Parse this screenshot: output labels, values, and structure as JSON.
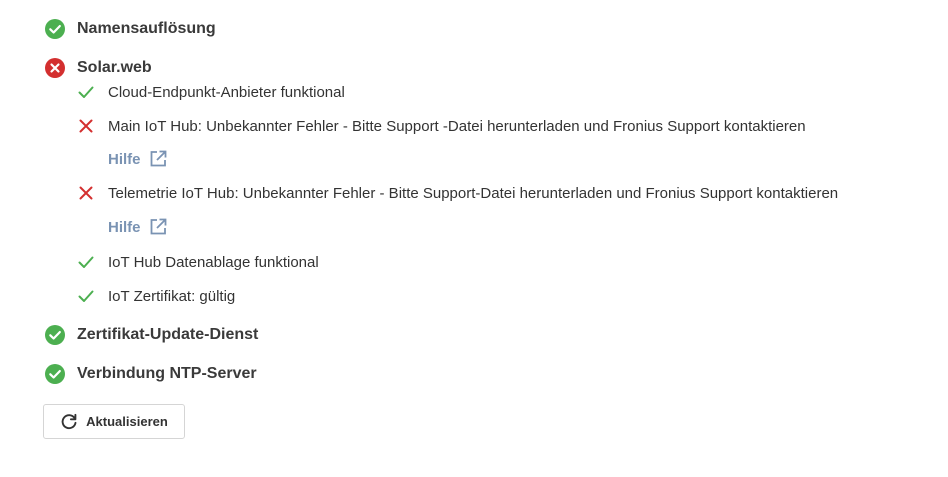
{
  "colors": {
    "ok": "#4caf50",
    "error": "#d32f2f",
    "link": "#7a93b3"
  },
  "checks": [
    {
      "label": "Namensauflösung",
      "status": "ok",
      "icon": "check-circle-icon"
    },
    {
      "label": "Solar.web",
      "status": "error",
      "icon": "error-circle-icon",
      "subchecks": [
        {
          "label": "Cloud-Endpunkt-Anbieter funktional",
          "status": "ok",
          "icon": "check-icon"
        },
        {
          "label": "Main IoT Hub: Unbekannter Fehler - Bitte Support -Datei herunterladen und Fronius Support kontaktieren",
          "status": "error",
          "icon": "cross-icon",
          "help": "Hilfe"
        },
        {
          "label": "Telemetrie IoT Hub: Unbekannter Fehler - Bitte Support-Datei herunterladen und Fronius Support kontaktieren",
          "status": "error",
          "icon": "cross-icon",
          "help": "Hilfe"
        },
        {
          "label": "IoT Hub Datenablage funktional",
          "status": "ok",
          "icon": "check-icon"
        },
        {
          "label": "IoT Zertifikat: gültig",
          "status": "ok",
          "icon": "check-icon"
        }
      ]
    },
    {
      "label": "Zertifikat-Update-Dienst",
      "status": "ok",
      "icon": "check-circle-icon"
    },
    {
      "label": "Verbindung NTP-Server",
      "status": "ok",
      "icon": "check-circle-icon"
    }
  ],
  "refresh_button": {
    "label": "Aktualisieren",
    "icon": "refresh-icon"
  }
}
